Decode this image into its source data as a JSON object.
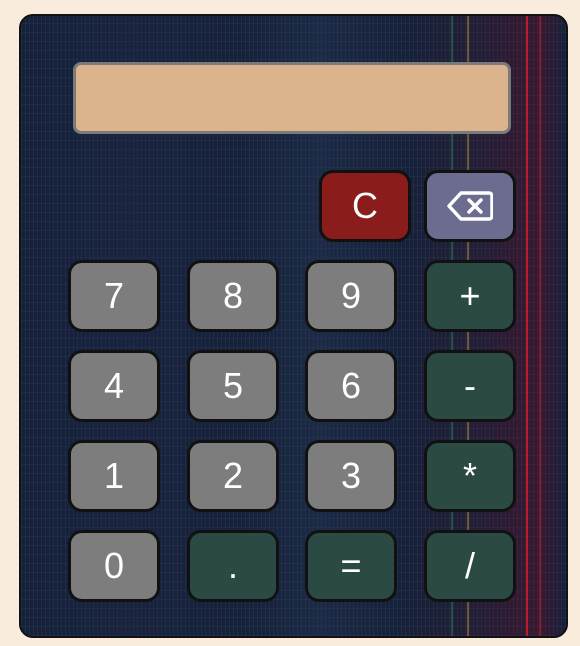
{
  "display": {
    "value": ""
  },
  "keys": {
    "clear": "C",
    "backspace_icon": "backspace-icon",
    "k7": "7",
    "k8": "8",
    "k9": "9",
    "plus": "+",
    "k4": "4",
    "k5": "5",
    "k6": "6",
    "minus": "-",
    "k1": "1",
    "k2": "2",
    "k3": "3",
    "multiply": "*",
    "k0": "0",
    "dot": ".",
    "equals": "=",
    "divide": "/"
  },
  "colors": {
    "page_bg": "#faecdc",
    "display_bg": "#dcb38d",
    "number_key": "#7d7d7d",
    "operator_key": "#2b4a43",
    "clear_key": "#8b1c1c",
    "backspace_key": "#6b6c8f"
  }
}
